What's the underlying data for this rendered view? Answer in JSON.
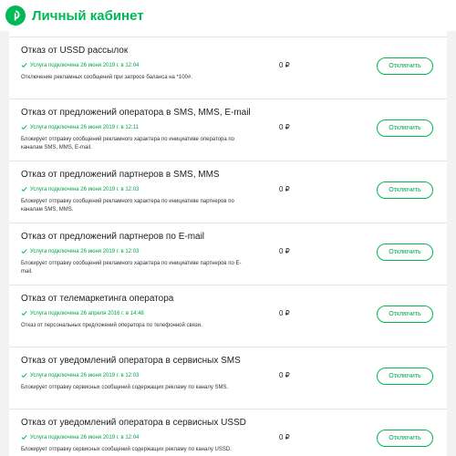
{
  "header": {
    "title": "Личный кабинет",
    "logo_icon": "megafon-logo-icon",
    "brand_color": "#00b956"
  },
  "services": [
    {
      "title": "Отказ от USSD рассылок",
      "status": "Услуга подключена 26 июня 2019 г. в 12:04",
      "description": "Отключение рекламных сообщений при запросе баланса на *100#.",
      "price": "0 ₽",
      "button": "Отключить"
    },
    {
      "title": "Отказ от предложений оператора в SMS, MMS, E-mail",
      "status": "Услуга подключена 26 июня 2019 г. в 12:11",
      "description": "Блокирует отправку сообщений рекламного характера по инициативе оператора по каналам SMS, MMS, E-mail.",
      "price": "0 ₽",
      "button": "Отключить"
    },
    {
      "title": "Отказ от предложений партнеров в SMS, MMS",
      "status": "Услуга подключена 26 июня 2019 г. в 12:03",
      "description": "Блокирует отправку сообщений рекламного характера по инициативе партнеров по каналам SMS, MMS.",
      "price": "0 ₽",
      "button": "Отключить"
    },
    {
      "title": "Отказ от предложений партнеров по E-mail",
      "status": "Услуга подключена 26 июня 2019 г. в 12:03",
      "description": "Блокирует отправку сообщений рекламного характера по инициативе партнеров по E-mail.",
      "price": "0 ₽",
      "button": "Отключить"
    },
    {
      "title": "Отказ от телемаркетинга оператора",
      "status": "Услуга подключена 26 апреля 2016 г. в 14:48",
      "description": "Отказ от персональных предложений оператора по телефонной связи.",
      "price": "0 ₽",
      "button": "Отключить"
    },
    {
      "title": "Отказ от уведомлений оператора в сервисных SMS",
      "status": "Услуга подключена 26 июня 2019 г. в 12:03",
      "description": "Блокирует отправку сервисных сообщений содержащих рекламу по каналу SMS.",
      "price": "0 ₽",
      "button": "Отключить"
    },
    {
      "title": "Отказ от уведомлений оператора в сервисных USSD",
      "status": "Услуга подключена 26 июня 2019 г. в 12:04",
      "description": "Блокирует отправку сервисных сообщений содержащих рекламу по каналу USSD.",
      "price": "0 ₽",
      "button": "Отключить"
    }
  ]
}
